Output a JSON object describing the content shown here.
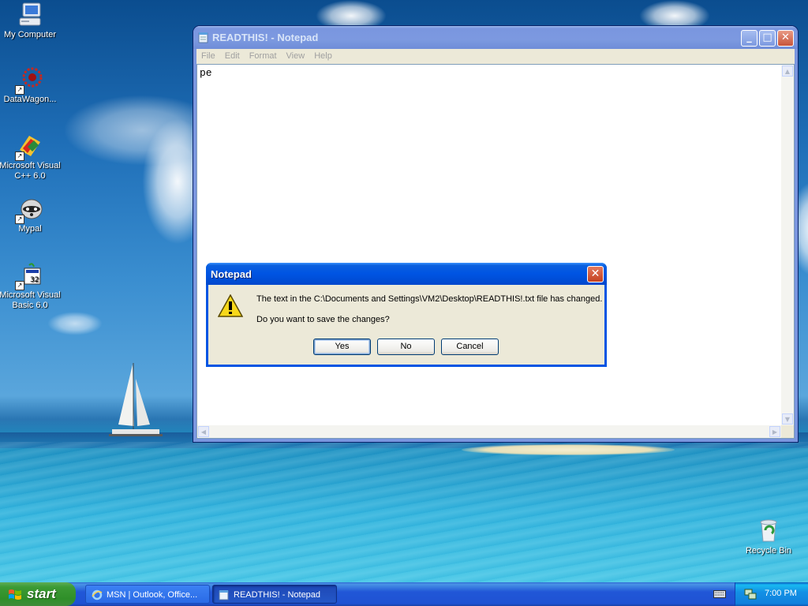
{
  "desktop": {
    "icons": [
      {
        "label": "My Computer",
        "icon": "my-computer-icon"
      },
      {
        "label": "DataWagon...",
        "icon": "datawagon-icon"
      },
      {
        "label": "Microsoft Visual C++ 6.0",
        "icon": "visual-cpp-icon"
      },
      {
        "label": "Mypal",
        "icon": "mypal-icon"
      },
      {
        "label": "Microsoft Visual Basic 6.0",
        "icon": "visual-basic-icon"
      },
      {
        "label": "Recycle Bin",
        "icon": "recycle-bin-icon"
      }
    ]
  },
  "notepad": {
    "title": "READTHIS! - Notepad",
    "menu": [
      "File",
      "Edit",
      "Format",
      "View",
      "Help"
    ],
    "content": "pe",
    "controls": {
      "minimize": "_",
      "maximize": "□",
      "close": "✕"
    }
  },
  "dialog": {
    "title": "Notepad",
    "message": "The text in the C:\\Documents and Settings\\VM2\\Desktop\\READTHIS!.txt file has changed.",
    "question": "Do you want to save the changes?",
    "buttons": {
      "yes": "Yes",
      "no": "No",
      "cancel": "Cancel"
    },
    "close": "✕",
    "icon": "warning-icon"
  },
  "taskbar": {
    "start_label": "start",
    "tasks": [
      {
        "label": "MSN | Outlook, Office...",
        "icon": "internet-explorer-icon",
        "active": false
      },
      {
        "label": "READTHIS! - Notepad",
        "icon": "notepad-icon",
        "active": true
      }
    ],
    "clock": "7:00 PM"
  },
  "colors": {
    "xp_blue": "#0054e3",
    "start_green": "#3c9a34",
    "dialog_face": "#ece9d8"
  }
}
